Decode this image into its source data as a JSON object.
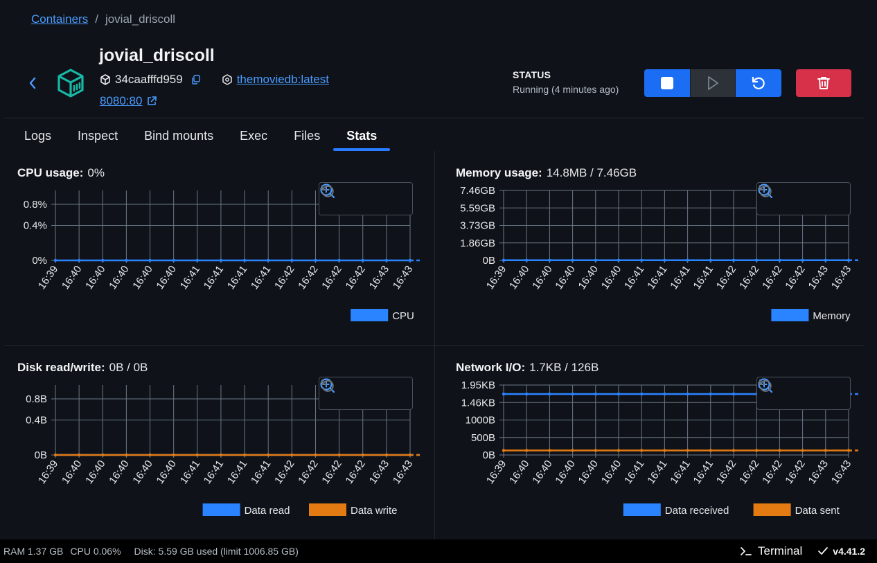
{
  "breadcrumb": {
    "root": "Containers",
    "separator": "/",
    "current": "jovial_driscoll"
  },
  "container": {
    "name": "jovial_driscoll",
    "id": "34caafffd959",
    "image": "themoviedb:latest",
    "port": "8080:80"
  },
  "status": {
    "label": "STATUS",
    "value": "Running (4 minutes ago)"
  },
  "tabs": [
    {
      "label": "Logs"
    },
    {
      "label": "Inspect"
    },
    {
      "label": "Bind mounts"
    },
    {
      "label": "Exec"
    },
    {
      "label": "Files"
    },
    {
      "label": "Stats",
      "active": true
    }
  ],
  "colors": {
    "accent": "#1b6ef3",
    "series_blue": "#2a84ff",
    "series_orange": "#e37a12",
    "danger": "#d63148",
    "grid": "#6b7785"
  },
  "charts": {
    "cpu": {
      "label": "CPU usage:",
      "value": "0%"
    },
    "memory": {
      "label": "Memory usage:",
      "value": "14.8MB / 7.46GB"
    },
    "disk": {
      "label": "Disk read/write:",
      "value": "0B / 0B"
    },
    "network": {
      "label": "Network I/O:",
      "value": "1.7KB / 126B"
    }
  },
  "chart_data": [
    {
      "id": "cpu",
      "type": "line",
      "x": [
        "16:39",
        "16:40",
        "16:40",
        "16:40",
        "16:40",
        "16:40",
        "16:41",
        "16:41",
        "16:41",
        "16:41",
        "16:42",
        "16:42",
        "16:42",
        "16:42",
        "16:43",
        "16:43"
      ],
      "ytick_labels": [
        "0%",
        "0.4%",
        "0.8%"
      ],
      "ylim": [
        0,
        0.8
      ],
      "grid": true,
      "legend": "bottom-right",
      "series": [
        {
          "name": "CPU",
          "color": "#2a84ff",
          "values": [
            0,
            0,
            0,
            0,
            0,
            0,
            0,
            0,
            0,
            0,
            0,
            0,
            0,
            0,
            0,
            0
          ]
        }
      ]
    },
    {
      "id": "memory",
      "type": "line",
      "x": [
        "16:39",
        "16:40",
        "16:40",
        "16:40",
        "16:40",
        "16:40",
        "16:41",
        "16:41",
        "16:41",
        "16:41",
        "16:42",
        "16:42",
        "16:42",
        "16:42",
        "16:43",
        "16:43"
      ],
      "ytick_labels": [
        "0B",
        "1.86GB",
        "3.73GB",
        "5.59GB",
        "7.46GB"
      ],
      "ylim": [
        0,
        7.46
      ],
      "grid": true,
      "legend": "bottom-right",
      "series": [
        {
          "name": "Memory",
          "color": "#2a84ff",
          "values": [
            0.0148,
            0.0148,
            0.0148,
            0.0148,
            0.0148,
            0.0148,
            0.0148,
            0.0148,
            0.0148,
            0.0148,
            0.0148,
            0.0148,
            0.0148,
            0.0148,
            0.0148,
            0.0148
          ]
        }
      ]
    },
    {
      "id": "disk",
      "type": "line",
      "x": [
        "16:39",
        "16:40",
        "16:40",
        "16:40",
        "16:40",
        "16:40",
        "16:41",
        "16:41",
        "16:41",
        "16:41",
        "16:42",
        "16:42",
        "16:42",
        "16:42",
        "16:43",
        "16:43"
      ],
      "ytick_labels": [
        "0B",
        "0.4B",
        "0.8B"
      ],
      "ylim": [
        0,
        0.8
      ],
      "grid": true,
      "legend": "bottom-right",
      "series": [
        {
          "name": "Data read",
          "color": "#2a84ff",
          "values": [
            0,
            0,
            0,
            0,
            0,
            0,
            0,
            0,
            0,
            0,
            0,
            0,
            0,
            0,
            0,
            0
          ]
        },
        {
          "name": "Data write",
          "color": "#e37a12",
          "values": [
            0,
            0,
            0,
            0,
            0,
            0,
            0,
            0,
            0,
            0,
            0,
            0,
            0,
            0,
            0,
            0
          ]
        }
      ]
    },
    {
      "id": "network",
      "type": "line",
      "x": [
        "16:39",
        "16:40",
        "16:40",
        "16:40",
        "16:40",
        "16:40",
        "16:41",
        "16:41",
        "16:41",
        "16:41",
        "16:42",
        "16:42",
        "16:42",
        "16:42",
        "16:43",
        "16:43"
      ],
      "ytick_labels": [
        "0B",
        "500B",
        "1000B",
        "1.46KB",
        "1.95KB"
      ],
      "ylim": [
        0,
        1950
      ],
      "grid": true,
      "legend": "bottom-right",
      "series": [
        {
          "name": "Data received",
          "color": "#2a84ff",
          "values": [
            1700,
            1700,
            1700,
            1700,
            1700,
            1700,
            1700,
            1700,
            1700,
            1700,
            1700,
            1700,
            1700,
            1700,
            1700,
            1700
          ]
        },
        {
          "name": "Data sent",
          "color": "#e37a12",
          "values": [
            126,
            126,
            126,
            126,
            126,
            126,
            126,
            126,
            126,
            126,
            126,
            126,
            126,
            126,
            126,
            126
          ]
        }
      ]
    }
  ],
  "statusbar": {
    "ram": "RAM 1.37 GB",
    "cpu": "CPU 0.06%",
    "disk": "Disk: 5.59 GB used (limit 1006.85 GB)",
    "terminal": "Terminal",
    "version": "v4.41.2"
  }
}
